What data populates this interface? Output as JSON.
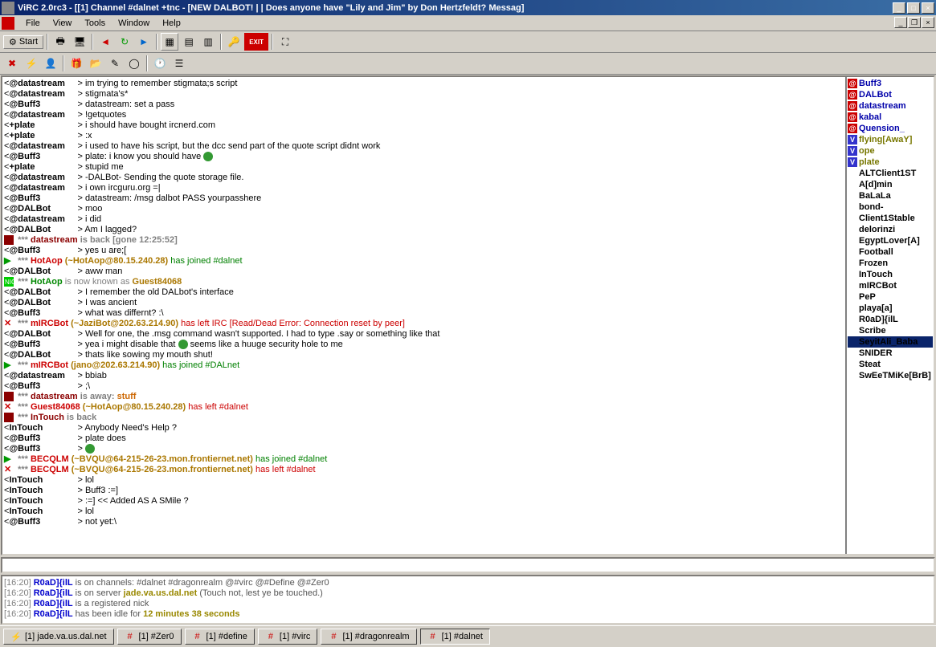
{
  "window": {
    "title": "ViRC 2.0rc3 - [[1] Channel #dalnet +tnc - [NEW DALBOT! | | Does anyone have \"Lily and Jim\" by Don Hertzfeldt? Messag]"
  },
  "menu": {
    "items": [
      "File",
      "View",
      "Tools",
      "Window",
      "Help"
    ]
  },
  "toolbar1": {
    "start": "Start"
  },
  "chat": [
    {
      "t": "msg",
      "n": "@datastream",
      "m": "im trying to remember stigmata;s script"
    },
    {
      "t": "msg",
      "n": "@datastream",
      "m": "stigmata's*"
    },
    {
      "t": "msg",
      "n": "@Buff3",
      "m": "datastream: set a pass"
    },
    {
      "t": "msg",
      "n": "@datastream",
      "m": "!getquotes"
    },
    {
      "t": "msg",
      "n": "+plate",
      "m": "i should have bought ircnerd.com"
    },
    {
      "t": "msg",
      "n": "+plate",
      "m": ":x"
    },
    {
      "t": "msg",
      "n": "@datastream",
      "m": "i used to have his script, but the dcc send part of the quote script didnt work"
    },
    {
      "t": "msg",
      "n": "@Buff3",
      "m": "plate: i know you should have ",
      "smiley": true
    },
    {
      "t": "msg",
      "n": "+plate",
      "m": "stupid me"
    },
    {
      "t": "msg",
      "n": "@datastream",
      "m": "-DALBot- Sending the quote storage file."
    },
    {
      "t": "msg",
      "n": "@datastream",
      "m": "i own ircguru.org =|"
    },
    {
      "t": "msg",
      "n": "@Buff3",
      "m": "datastream: /msg dalbot PASS yourpasshere"
    },
    {
      "t": "msg",
      "n": "@DALBot",
      "m": "moo"
    },
    {
      "t": "msg",
      "n": "@datastream",
      "m": "i did"
    },
    {
      "t": "msg",
      "n": "@DALBot",
      "m": "Am I lagged?"
    },
    {
      "t": "back",
      "nick": "datastream",
      "rest": "is back [gone 12:25:52]"
    },
    {
      "t": "msg",
      "n": "@Buff3",
      "m": "yes u are;["
    },
    {
      "t": "join",
      "nick": "HotAop",
      "host": "(~HotAop@80.15.240.28)",
      "act": "has joined #dalnet"
    },
    {
      "t": "msg",
      "n": "@DALBot",
      "m": "aww man"
    },
    {
      "t": "nick",
      "nick": "HotAop",
      "rest": "is now known as",
      "new": "Guest84068"
    },
    {
      "t": "msg",
      "n": "@DALBot",
      "m": "I remember the old DALbot's interface"
    },
    {
      "t": "msg",
      "n": "@DALBot",
      "m": "I was ancient"
    },
    {
      "t": "msg",
      "n": "@Buff3",
      "m": "what was differnt? :\\"
    },
    {
      "t": "part",
      "nick": "mIRCBot",
      "host": "(~JaziBot@202.63.214.90)",
      "act": "has left IRC [Read/Dead Error: Connection reset by peer]"
    },
    {
      "t": "msg",
      "n": "@DALBot",
      "m": "Well for one, the .msg command wasn't supported. I had to type .say or something like that"
    },
    {
      "t": "msg",
      "n": "@Buff3",
      "m": "yea i might disable that ",
      "smiley": true,
      "m2": " seems like a huuge security hole to me"
    },
    {
      "t": "msg",
      "n": "@DALBot",
      "m": "thats like sowing my mouth shut!"
    },
    {
      "t": "join",
      "nick": "mIRCBot",
      "host": "(jano@202.63.214.90)",
      "act": "has joined #DALnet"
    },
    {
      "t": "msg",
      "n": "@datastream",
      "m": "bbiab"
    },
    {
      "t": "msg",
      "n": "@Buff3",
      "m": ";\\"
    },
    {
      "t": "away",
      "nick": "datastream",
      "rest": "is away:",
      "extra": "stuff"
    },
    {
      "t": "part",
      "nick": "Guest84068",
      "host": "(~HotAop@80.15.240.28)",
      "act": "has left #dalnet"
    },
    {
      "t": "back",
      "nick": "InTouch",
      "rest": "is back"
    },
    {
      "t": "msg",
      "n": "InTouch",
      "m": "Anybody Need's Help ?"
    },
    {
      "t": "msg",
      "n": "@Buff3",
      "m": "plate does"
    },
    {
      "t": "msg",
      "n": "@Buff3",
      "m": "",
      "smiley": true
    },
    {
      "t": "join",
      "nick": "BECQLM",
      "host": "(~BVQU@64-215-26-23.mon.frontiernet.net)",
      "act": "has joined #dalnet"
    },
    {
      "t": "part",
      "nick": "BECQLM",
      "host": "(~BVQU@64-215-26-23.mon.frontiernet.net)",
      "act": "has left #dalnet"
    },
    {
      "t": "msg",
      "n": "InTouch",
      "m": "lol"
    },
    {
      "t": "msg",
      "n": "InTouch",
      "m": "Buff3 :=]"
    },
    {
      "t": "msg",
      "n": "InTouch",
      "m": ":=] << Added AS A SMile ?"
    },
    {
      "t": "msg",
      "n": "InTouch",
      "m": "lol"
    },
    {
      "t": "msg",
      "n": "@Buff3",
      "m": "not yet:\\"
    }
  ],
  "nicklist": [
    {
      "n": "Buff3",
      "m": "op"
    },
    {
      "n": "DALBot",
      "m": "op"
    },
    {
      "n": "datastream",
      "m": "op"
    },
    {
      "n": "kabal",
      "m": "op"
    },
    {
      "n": "Quension_",
      "m": "op"
    },
    {
      "n": "flying[AwaY]",
      "m": "v"
    },
    {
      "n": "ope",
      "m": "v"
    },
    {
      "n": "plate",
      "m": "v"
    },
    {
      "n": "ALTClient1ST",
      "m": "n"
    },
    {
      "n": "A[d]min",
      "m": "n"
    },
    {
      "n": "BaLaLa",
      "m": "n"
    },
    {
      "n": "bond-",
      "m": "n"
    },
    {
      "n": "Client1Stable",
      "m": "n"
    },
    {
      "n": "delorinzi",
      "m": "n"
    },
    {
      "n": "EgyptLover[A]",
      "m": "n"
    },
    {
      "n": "Football",
      "m": "n"
    },
    {
      "n": "Frozen",
      "m": "n"
    },
    {
      "n": "InTouch",
      "m": "n"
    },
    {
      "n": "mIRCBot",
      "m": "n"
    },
    {
      "n": "PeP",
      "m": "n"
    },
    {
      "n": "playa[a]",
      "m": "n"
    },
    {
      "n": "R0aD]{ilL",
      "m": "n"
    },
    {
      "n": "Scribe",
      "m": "n"
    },
    {
      "n": "SeyitAli_Baba",
      "m": "n",
      "sel": true
    },
    {
      "n": "SNIDER",
      "m": "n"
    },
    {
      "n": "Steat",
      "m": "n"
    },
    {
      "n": "SwEeTMiKe[BrB]",
      "m": "n"
    }
  ],
  "status": [
    {
      "ts": "[16:20]",
      "nick": "R0aD]{ilL",
      "body": "is on channels: #dalnet #dragonrealm @#virc @#Define @#Zer0"
    },
    {
      "ts": "[16:20]",
      "nick": "R0aD]{ilL",
      "body": "is on server",
      "gold": "jade.va.us.dal.net",
      "rest": "(Touch not, lest ye be touched.)"
    },
    {
      "ts": "[16:20]",
      "nick": "R0aD]{ilL",
      "body": "is a registered nick"
    },
    {
      "ts": "[16:20]",
      "nick": "R0aD]{ilL",
      "body": "has been idle for",
      "gold": "12 minutes 38 seconds"
    }
  ],
  "tabs": [
    {
      "l": "[1] jade.va.us.dal.net",
      "ico": "server"
    },
    {
      "l": "[1] #Zer0",
      "ico": "chan"
    },
    {
      "l": "[1] #define",
      "ico": "chan"
    },
    {
      "l": "[1] #virc",
      "ico": "chan"
    },
    {
      "l": "[1] #dragonrealm",
      "ico": "chan"
    },
    {
      "l": "[1] #dalnet",
      "ico": "chan",
      "active": true
    }
  ]
}
